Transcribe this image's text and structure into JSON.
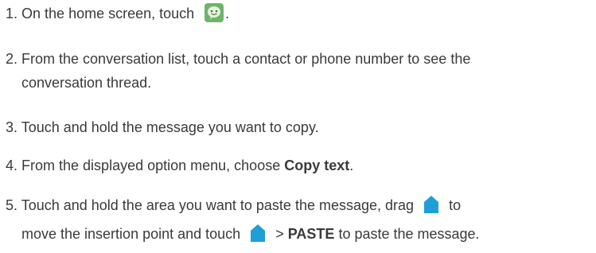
{
  "steps": [
    {
      "number": "1.",
      "before_icon": "On the home screen, touch",
      "icon": "messaging-app-icon",
      "after_icon": "."
    },
    {
      "number": "2.",
      "line1": "From the conversation list, touch a contact or phone number to see the",
      "line2": "conversation thread."
    },
    {
      "number": "3.",
      "text": "Touch and hold the message you want to copy."
    },
    {
      "number": "4.",
      "before_bold": "From the displayed option menu, choose",
      "bold": "Copy text",
      "after_bold": "."
    },
    {
      "number": "5.",
      "line1_before_icon": "Touch and hold the area you want to paste the message, drag",
      "line1_icon": "cursor-handle-icon",
      "line1_after_icon": "to",
      "line2_before_icon": "move the insertion point and touch",
      "line2_icon": "cursor-handle-icon",
      "line2_between": ">",
      "line2_bold": "PASTE",
      "line2_after_bold": "to paste the message."
    }
  ],
  "colors": {
    "text": "#3a3a3a",
    "handle": "#1e9fd8",
    "icon_bg": "#4f9d5a"
  }
}
